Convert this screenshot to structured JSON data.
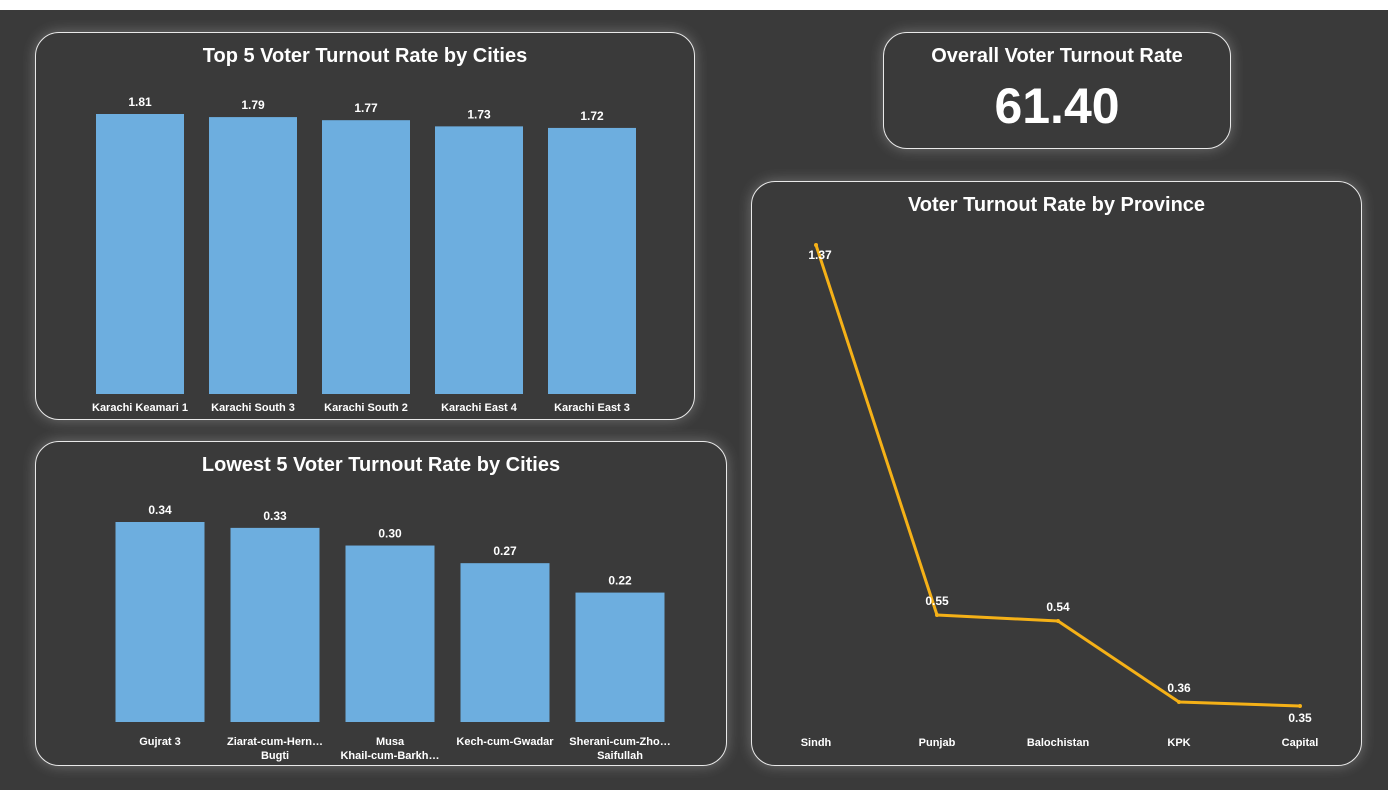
{
  "top_chart": {
    "title": "Top 5 Voter Turnout Rate by Cities"
  },
  "lowest_chart": {
    "title": "Lowest 5 Voter Turnout Rate by Cities"
  },
  "kpi": {
    "title": "Overall Voter Turnout Rate",
    "value": "61.40"
  },
  "province_chart": {
    "title": "Voter Turnout Rate by Province"
  },
  "colors": {
    "background": "#3a3a3a",
    "bar": "#6daedf",
    "line": "#f5b117",
    "text": "#ffffff"
  },
  "chart_data": [
    {
      "type": "bar",
      "title": "Top 5 Voter Turnout Rate by Cities",
      "categories": [
        "Karachi Keamari 1",
        "Karachi South 3",
        "Karachi South 2",
        "Karachi East 4",
        "Karachi East 3"
      ],
      "values": [
        1.81,
        1.79,
        1.77,
        1.73,
        1.72
      ],
      "value_labels": [
        "1.81",
        "1.79",
        "1.77",
        "1.73",
        "1.72"
      ],
      "ylim": [
        0,
        1.81
      ],
      "grid": false,
      "legend": "none"
    },
    {
      "type": "bar",
      "title": "Lowest 5 Voter Turnout Rate by Cities",
      "categories": [
        "Gujrat 3",
        "Ziarat-cum-Hern… Bugti",
        "Musa Khail-cum-Barkh…",
        "Kech-cum-Gwadar",
        "Sherani-cum-Zho… Saifullah"
      ],
      "category_lines": [
        [
          "Gujrat 3"
        ],
        [
          "Ziarat-cum-Hern…",
          "Bugti"
        ],
        [
          "Musa",
          "Khail-cum-Barkh…"
        ],
        [
          "Kech-cum-Gwadar"
        ],
        [
          "Sherani-cum-Zho…",
          "Saifullah"
        ]
      ],
      "values": [
        0.34,
        0.33,
        0.3,
        0.27,
        0.22
      ],
      "value_labels": [
        "0.34",
        "0.33",
        "0.30",
        "0.27",
        "0.22"
      ],
      "ylim": [
        0,
        0.34
      ],
      "grid": false,
      "legend": "none"
    },
    {
      "type": "line",
      "title": "Voter Turnout Rate by Province",
      "categories": [
        "Sindh",
        "Punjab",
        "Balochistan",
        "KPK",
        "Capital"
      ],
      "values": [
        1.37,
        0.55,
        0.54,
        0.36,
        0.35
      ],
      "value_labels": [
        "1.37",
        "0.55",
        "0.54",
        "0.36",
        "0.35"
      ],
      "ylim": [
        0,
        1.37
      ],
      "grid": false,
      "legend": "none"
    }
  ]
}
